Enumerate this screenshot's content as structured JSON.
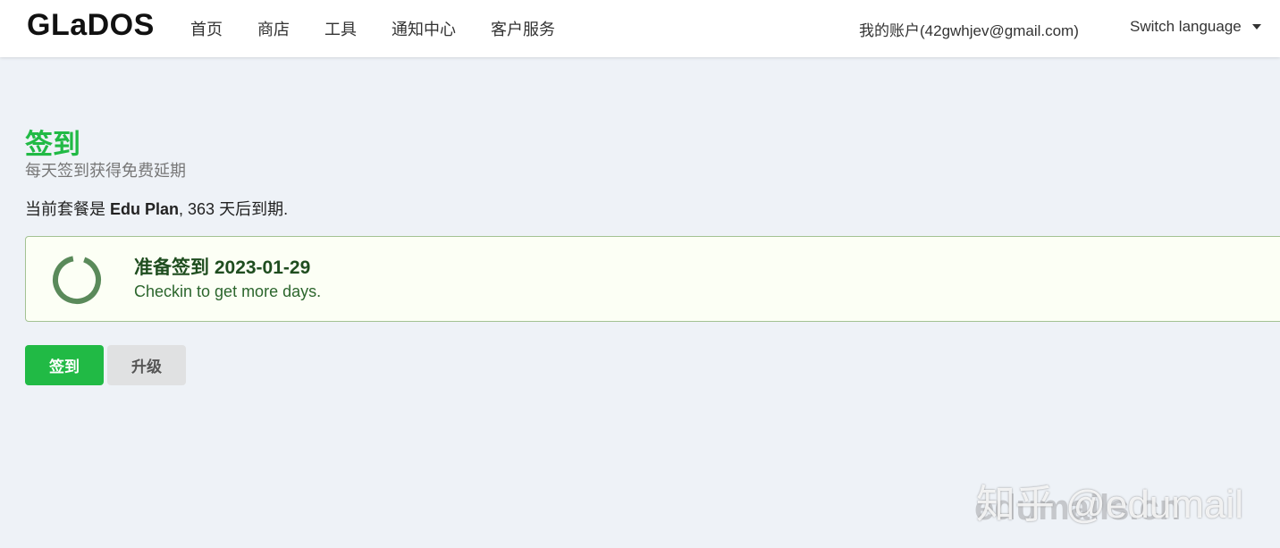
{
  "header": {
    "brand": "GLaDOS",
    "nav": [
      {
        "label": "首页"
      },
      {
        "label": "商店"
      },
      {
        "label": "工具"
      },
      {
        "label": "通知中心"
      },
      {
        "label": "客户服务"
      }
    ],
    "account": "我的账户(42gwhjev@gmail.com)",
    "language": "Switch language"
  },
  "main": {
    "title": "签到",
    "subtitle": "每天签到获得免费延期",
    "plan": {
      "prefix": "当前套餐是 ",
      "name": "Edu Plan",
      "suffix": ", 363 天后到期."
    },
    "card": {
      "title": "准备签到 2023-01-29",
      "description": "Checkin to get more days."
    },
    "buttons": {
      "checkin": "签到",
      "upgrade": "升级"
    }
  },
  "watermark": {
    "line1": "知乎 @edumail",
    "line2": "edumails.cn"
  },
  "colors": {
    "accent": "#21ba45",
    "card_bg": "#fcfff5",
    "card_border": "#a3c293",
    "spinner": "#5a8a5a"
  }
}
